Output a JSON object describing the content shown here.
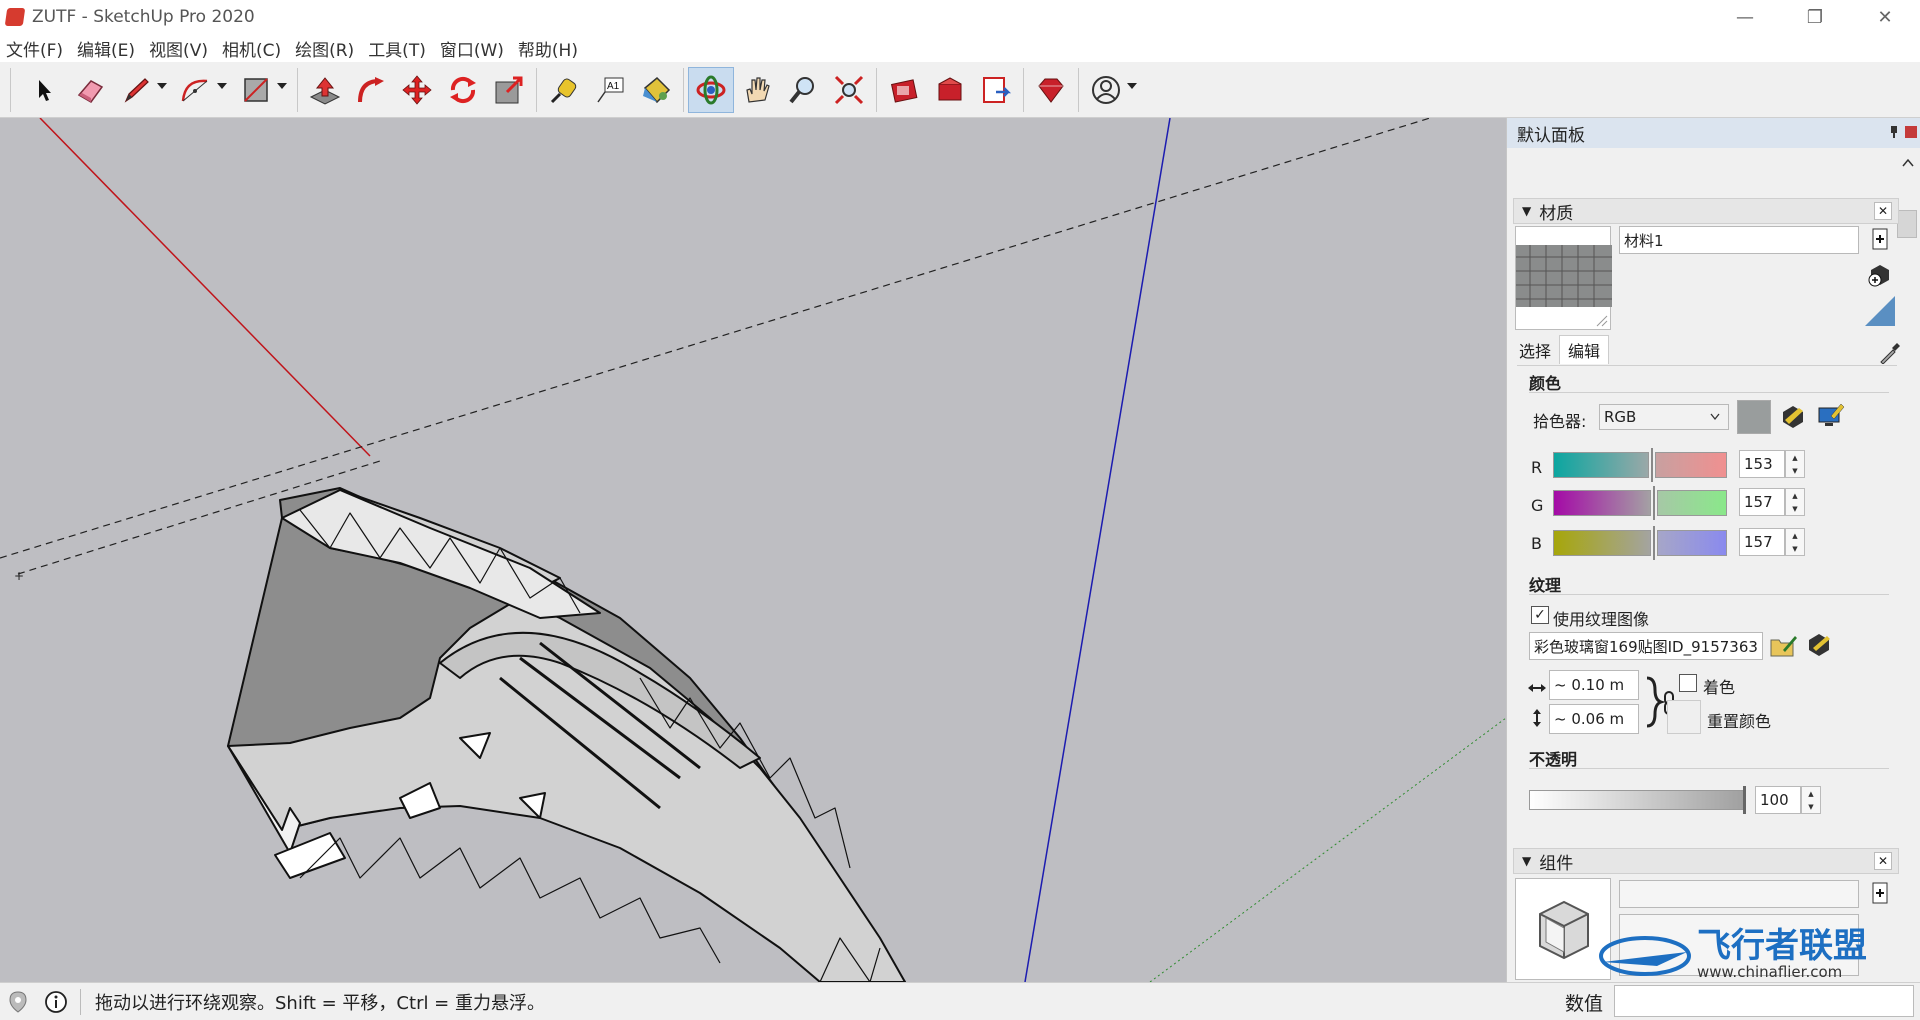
{
  "window": {
    "title": "ZUTF - SketchUp Pro 2020",
    "controls": [
      "minimize-icon",
      "restore-icon",
      "close-icon"
    ]
  },
  "menu": [
    "文件(F)",
    "编辑(E)",
    "视图(V)",
    "相机(C)",
    "绘图(R)",
    "工具(T)",
    "窗口(W)",
    "帮助(H)"
  ],
  "toolbar": {
    "active_tool": "orbit",
    "tools": [
      "select",
      "eraser",
      "pencil",
      "arc",
      "rectangle",
      "push-pull",
      "follow-me",
      "move",
      "rotate",
      "scale",
      "tape-measure",
      "text",
      "paint-bucket",
      "orbit",
      "pan",
      "zoom",
      "zoom-extents",
      "warehouse-3d",
      "extension-warehouse",
      "send-to-layout",
      "extension-manager",
      "account"
    ]
  },
  "panel": {
    "title": "默认面板",
    "materials": {
      "header": "材质",
      "material_name": "材料1",
      "tabs": [
        "选择",
        "编辑"
      ],
      "active_tab": "编辑",
      "color_section": "颜色",
      "picker_label": "拾色器:",
      "picker_value": "RGB",
      "swatch_color": "#999d9d",
      "r_label": "R",
      "g_label": "G",
      "b_label": "B",
      "r_value": "153",
      "g_value": "157",
      "b_value": "157",
      "texture_section": "纹理",
      "use_texture_label": "使用纹理图像",
      "use_texture_checked": true,
      "texture_file": "彩色玻璃窗169贴图ID_9157363",
      "width_value": "~ 0.10 m",
      "height_value": "~ 0.06 m",
      "colorize_label": "着色",
      "reset_color_label": "重置颜色",
      "opacity_section": "不透明",
      "opacity_value": "100"
    },
    "components": {
      "header": "组件"
    }
  },
  "status": {
    "hint": "拖动以进行环绕观察。Shift = 平移，Ctrl = 重力悬浮。",
    "vcb_label": "数值"
  },
  "watermark": {
    "brand": "飞行者联盟",
    "url": "www.chinaflier.com"
  },
  "colors": {
    "viewport_bg": "#bebec2",
    "red_axis": "#c0141a",
    "blue_axis": "#1c1cb0",
    "green_axis": "#2e8b2e"
  }
}
